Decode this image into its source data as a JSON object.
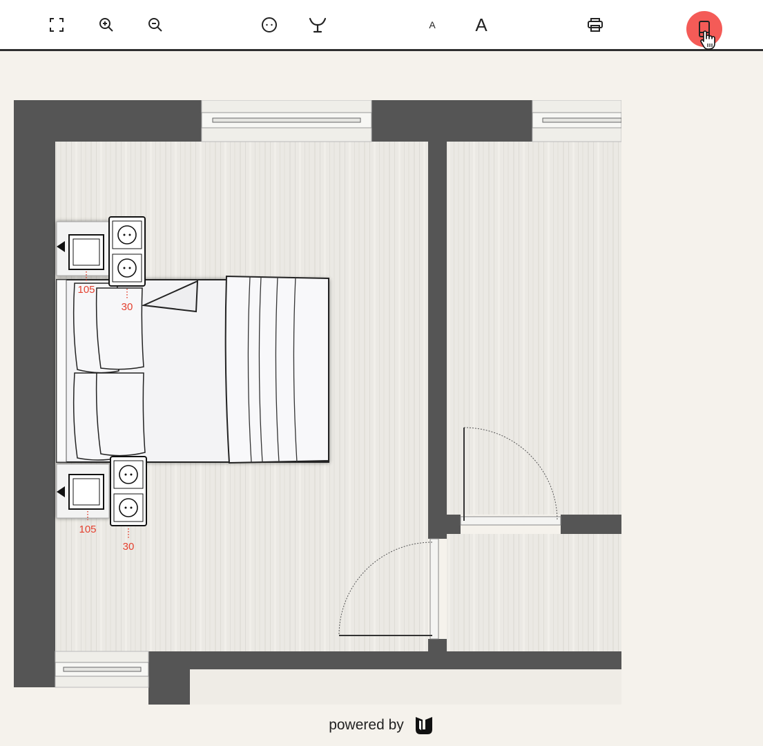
{
  "toolbar": {
    "buttons": [
      {
        "icon": "fullscreen-icon"
      },
      {
        "icon": "zoom-in-icon"
      },
      {
        "icon": "zoom-out-icon"
      },
      {
        "icon": "smiley-icon"
      },
      {
        "icon": "branch-icon"
      },
      {
        "label": "A",
        "icon": "font-decrease"
      },
      {
        "label": "A",
        "icon": "font-increase"
      },
      {
        "icon": "print-icon"
      },
      {
        "icon": "mobile-device-icon",
        "active": true
      }
    ],
    "active_color": "#f45b57"
  },
  "floorplan": {
    "sockets": [
      {
        "height_label": "105"
      },
      {
        "height_label": "30"
      },
      {
        "height_label": "105"
      },
      {
        "height_label": "30"
      }
    ],
    "marker_color": "#e4402f",
    "wall_color": "#555555"
  },
  "footer": {
    "text": "powered by"
  }
}
